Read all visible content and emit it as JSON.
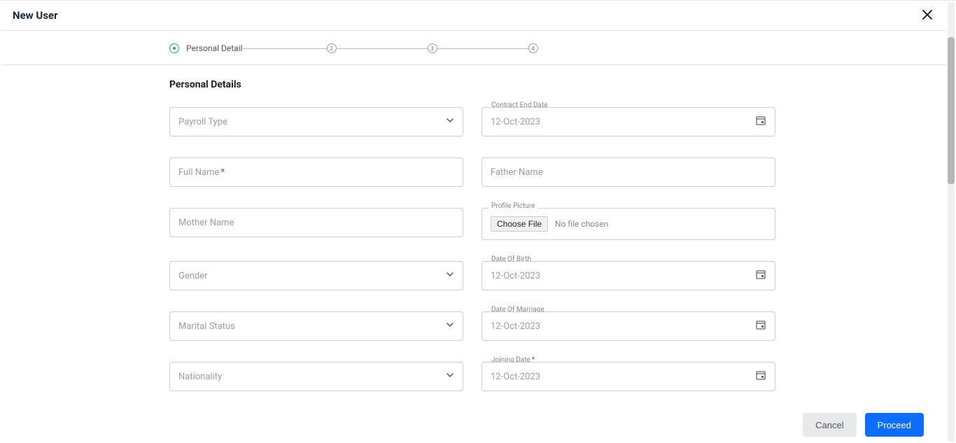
{
  "header": {
    "title": "New User"
  },
  "stepper": {
    "steps": [
      {
        "label": "Personal Detail"
      },
      {
        "num": "2"
      },
      {
        "num": "3"
      },
      {
        "num": "4"
      }
    ]
  },
  "section_title": "Personal Details",
  "fields": {
    "payroll_type": {
      "placeholder": "Payroll Type"
    },
    "contract_end": {
      "label": "Contract End Date",
      "value": "12-Oct-2023"
    },
    "full_name": {
      "placeholder": "Full Name"
    },
    "father_name": {
      "placeholder": "Father Name"
    },
    "mother_name": {
      "placeholder": "Mother Name"
    },
    "profile_picture": {
      "label": "Profile Picture",
      "button": "Choose File",
      "status": "No file chosen"
    },
    "gender": {
      "placeholder": "Gender"
    },
    "dob": {
      "label": "Date Of Birth",
      "value": "12-Oct-2023"
    },
    "marital_status": {
      "placeholder": "Marital Status"
    },
    "dom": {
      "label": "Date Of Marriage",
      "value": "12-Oct-2023"
    },
    "nationality": {
      "placeholder": "Nationality"
    },
    "joining_date": {
      "label": "Joining Date",
      "value": "12-Oct-2023"
    }
  },
  "footer": {
    "cancel": "Cancel",
    "proceed": "Proceed"
  }
}
